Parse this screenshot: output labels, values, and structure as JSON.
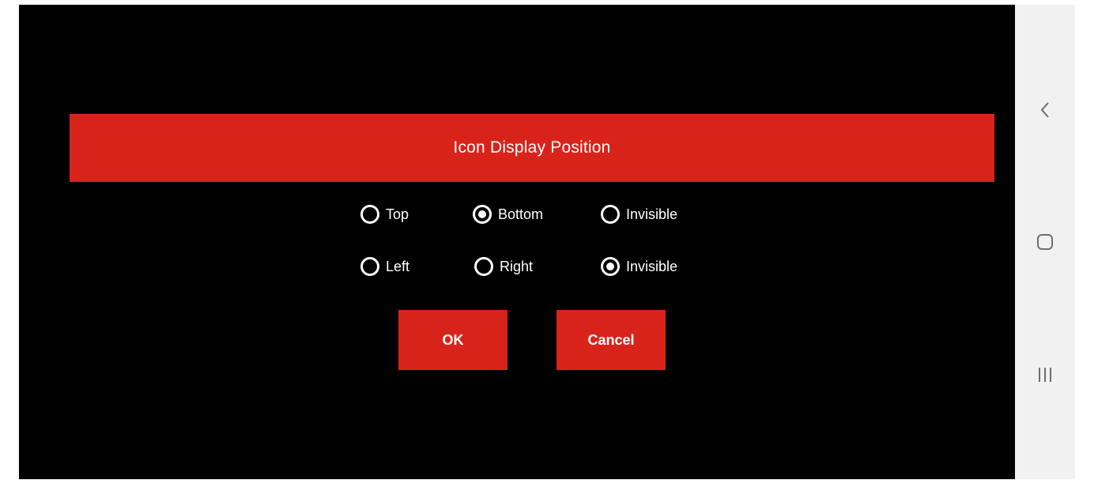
{
  "dialog": {
    "title": "Icon Display Position",
    "vertical_options": [
      {
        "label": "Top",
        "selected": false
      },
      {
        "label": "Bottom",
        "selected": true
      },
      {
        "label": "Invisible",
        "selected": false
      }
    ],
    "horizontal_options": [
      {
        "label": "Left",
        "selected": false
      },
      {
        "label": "Right",
        "selected": false
      },
      {
        "label": "Invisible",
        "selected": true
      }
    ],
    "ok_label": "OK",
    "cancel_label": "Cancel"
  },
  "navbar": {
    "icons": [
      "back-icon",
      "home-icon",
      "recents-icon"
    ]
  },
  "colors": {
    "accent": "#d8231b",
    "background": "#000000",
    "navbar": "#f1f1f1"
  }
}
